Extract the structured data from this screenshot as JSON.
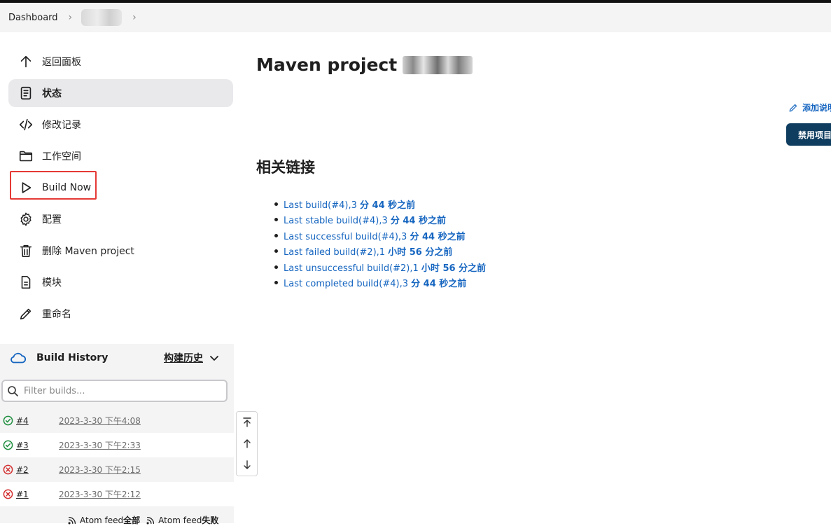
{
  "breadcrumb": {
    "dashboard": "Dashboard"
  },
  "sidebar": {
    "items": [
      {
        "label": "返回面板",
        "icon": "arrow-up-icon"
      },
      {
        "label": "状态",
        "icon": "document-icon"
      },
      {
        "label": "修改记录",
        "icon": "code-icon"
      },
      {
        "label": "工作空间",
        "icon": "folder-icon"
      },
      {
        "label": "Build Now",
        "icon": "play-icon"
      },
      {
        "label": "配置",
        "icon": "gear-icon"
      },
      {
        "label": "删除 Maven project",
        "icon": "trash-icon"
      },
      {
        "label": "模块",
        "icon": "file-icon"
      },
      {
        "label": "重命名",
        "icon": "pencil-icon"
      }
    ]
  },
  "history": {
    "title": "Build History",
    "trend_label": "构建历史",
    "filter_placeholder": "Filter builds...",
    "builds": [
      {
        "number": "#4",
        "time": "2023-3-30 下午4:08",
        "status": "success"
      },
      {
        "number": "#3",
        "time": "2023-3-30 下午2:33",
        "status": "success"
      },
      {
        "number": "#2",
        "time": "2023-3-30 下午2:15",
        "status": "failed"
      },
      {
        "number": "#1",
        "time": "2023-3-30 下午2:12",
        "status": "failed"
      }
    ],
    "feeds": [
      {
        "prefix": "Atom feed ",
        "suffix": "全部"
      },
      {
        "prefix": "Atom feed ",
        "suffix": "失败"
      }
    ]
  },
  "main": {
    "title": "Maven project",
    "add_description": "添加说明",
    "disable_button": "禁用项目",
    "related_title": "相关链接",
    "links": [
      {
        "text": "Last build(#4),3 ",
        "bold": "分 44 秒之前"
      },
      {
        "text": "Last stable build(#4),3 ",
        "bold": "分 44 秒之前"
      },
      {
        "text": "Last successful build(#4),3 ",
        "bold": "分 44 秒之前"
      },
      {
        "text": "Last failed build(#2),1 ",
        "bold": "小时 56 分之前"
      },
      {
        "text": "Last unsuccessful build(#2),1 ",
        "bold": "小时 56 分之前"
      },
      {
        "text": "Last completed build(#4),3 ",
        "bold": "分 44 秒之前"
      }
    ]
  },
  "colors": {
    "success": "#1e8e3e",
    "failed": "#d32f2f",
    "link": "#1565c0",
    "button": "#0f3d5f",
    "highlight": "#e53935"
  }
}
